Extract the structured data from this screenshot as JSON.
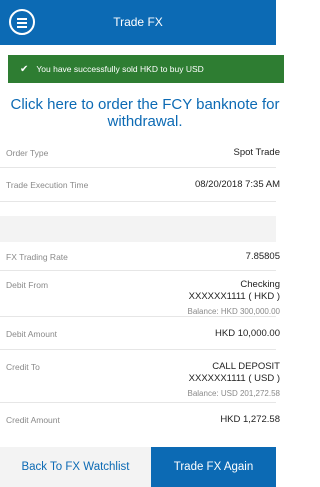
{
  "header": {
    "title": "Trade FX",
    "menu_icon": "hamburger-menu-icon"
  },
  "alert": {
    "icon": "check-icon",
    "message": "You have successfully sold HKD to buy USD",
    "color": "#2e7d32"
  },
  "banknote_link": "Click here to order the FCY banknote for withdrawal.",
  "details": {
    "order_type": {
      "label": "Order Type",
      "value": "Spot Trade"
    },
    "execution_time": {
      "label": "Trade Execution Time",
      "value": "08/20/2018 7:35 AM"
    },
    "fx_rate": {
      "label": "FX Trading Rate",
      "value": "7.85805"
    },
    "debit_from": {
      "label": "Debit From",
      "line1": "Checking",
      "line2": "XXXXXX1111 ( HKD )",
      "balance": "Balance: HKD 300,000.00"
    },
    "debit_amount": {
      "label": "Debit Amount",
      "value": "HKD 10,000.00"
    },
    "credit_to": {
      "label": "Credit To",
      "line1": "CALL DEPOSIT",
      "line2": "XXXXXX1111 ( USD )",
      "balance": "Balance: USD 201,272.58"
    },
    "credit_amount": {
      "label": "Credit Amount",
      "value": "HKD 1,272.58"
    }
  },
  "footer": {
    "back_label": "Back To FX Watchlist",
    "again_label": "Trade FX Again"
  },
  "colors": {
    "primary": "#0c6ab4",
    "success": "#2e7d32"
  }
}
